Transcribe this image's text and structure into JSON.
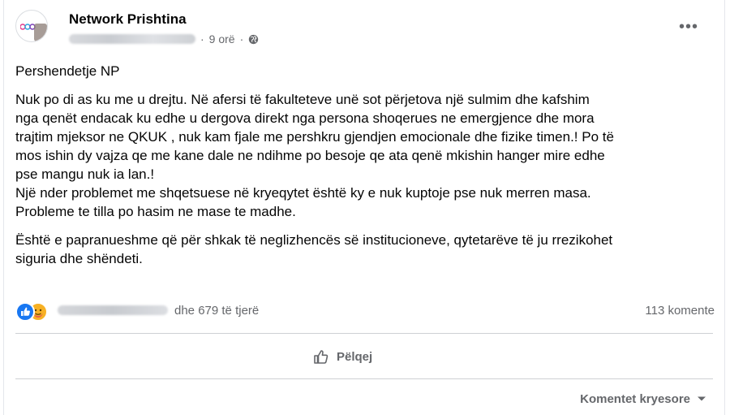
{
  "post": {
    "page_name": "Network Prishtina",
    "time": "9 orë",
    "separator": "·",
    "greeting": "Pershendetje NP",
    "paragraph_lines": [
      "Nuk po di as ku me u drejtu.  Në afersi të fakulteteve unë sot përjetova një sulmim dhe kafshim",
      "nga qenët endacak ku edhe u dergova direkt nga persona shoqerues ne emergjence dhe mora",
      "trajtim mjeksor ne QKUK , nuk kam fjale me pershkru gjendjen emocionale dhe fizike timen.! Po të",
      "mos ishin dy vajza qe me kane dale ne ndihme po besoje qe ata qenë mkishin hanger mire edhe",
      "pse mangu nuk ia lan.!",
      "Një nder problemet me shqetsuese  në kryeqytet është ky e nuk kuptoje pse nuk merren masa.",
      "Probleme te tilla po hasim ne mase te madhe."
    ],
    "closing_lines": [
      "Është e papranueshme që për shkak të neglizhencës së institucioneve, qytetarëve të ju rrezikohet",
      "siguria dhe shëndeti."
    ]
  },
  "reactions": {
    "others_text": "dhe 679 të tjerë",
    "comments_text": "113 komente",
    "icons": [
      "like-icon",
      "care-icon"
    ]
  },
  "actions": {
    "like_label": "Pëlqej"
  },
  "comments": {
    "sort_label": "Komentet kryesore"
  },
  "colors": {
    "like_blue": "#1877f2",
    "care_yellow": "#f7b125",
    "secondary_text": "#65676b"
  }
}
